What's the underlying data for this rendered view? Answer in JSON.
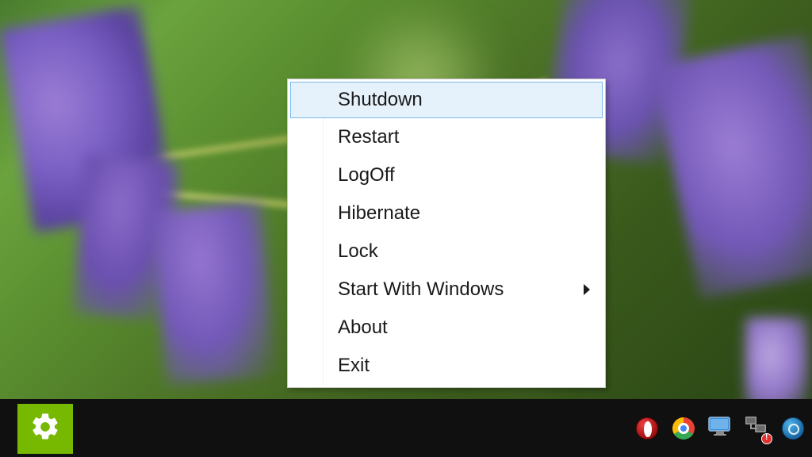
{
  "menu": {
    "items": [
      {
        "label": "Shutdown",
        "highlighted": true,
        "submenu": false
      },
      {
        "label": "Restart",
        "highlighted": false,
        "submenu": false
      },
      {
        "label": "LogOff",
        "highlighted": false,
        "submenu": false
      },
      {
        "label": "Hibernate",
        "highlighted": false,
        "submenu": false
      },
      {
        "label": "Lock",
        "highlighted": false,
        "submenu": false
      },
      {
        "label": "Start With Windows",
        "highlighted": false,
        "submenu": true
      },
      {
        "label": "About",
        "highlighted": false,
        "submenu": false
      },
      {
        "label": "Exit",
        "highlighted": false,
        "submenu": false
      }
    ]
  },
  "taskbar": {
    "start_icon": "gear-icon",
    "tray_icons": [
      {
        "name": "opera-icon"
      },
      {
        "name": "chrome-icon"
      },
      {
        "name": "monitor-icon"
      },
      {
        "name": "network-icon",
        "alert": true
      },
      {
        "name": "app-icon"
      }
    ]
  }
}
